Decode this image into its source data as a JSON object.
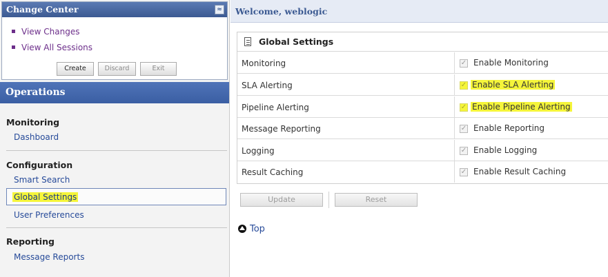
{
  "change_center": {
    "title": "Change Center",
    "collapse_glyph": "≈",
    "links": [
      "View Changes",
      "View All Sessions"
    ],
    "buttons": {
      "create": "Create",
      "discard": "Discard",
      "exit": "Exit"
    }
  },
  "operations": {
    "title": "Operations",
    "sections": [
      {
        "title": "Monitoring",
        "items": [
          "Dashboard"
        ]
      },
      {
        "title": "Configuration",
        "items": [
          "Smart Search",
          "Global Settings",
          "User Preferences"
        ]
      },
      {
        "title": "Reporting",
        "items": [
          "Message Reports"
        ]
      }
    ],
    "selected_item": "Global Settings"
  },
  "welcome": "Welcome, weblogic",
  "global_settings": {
    "title": "Global Settings",
    "rows": [
      {
        "label": "Monitoring",
        "option": "Enable Monitoring",
        "checked": true,
        "highlighted": false
      },
      {
        "label": "SLA Alerting",
        "option": "Enable SLA Alerting",
        "checked": true,
        "highlighted": true
      },
      {
        "label": "Pipeline Alerting",
        "option": "Enable Pipeline Alerting",
        "checked": true,
        "highlighted": true
      },
      {
        "label": "Message Reporting",
        "option": "Enable Reporting",
        "checked": true,
        "highlighted": false
      },
      {
        "label": "Logging",
        "option": "Enable Logging",
        "checked": true,
        "highlighted": false
      },
      {
        "label": "Result Caching",
        "option": "Enable Result Caching",
        "checked": true,
        "highlighted": false
      }
    ]
  },
  "actions": {
    "update": "Update",
    "reset": "Reset"
  },
  "top_link": "Top",
  "colors": {
    "header_blue": "#3c5a92",
    "link_blue": "#264a99",
    "visited_purple": "#6c2e8a",
    "highlight_yellow": "#f5f53a"
  },
  "icons": {
    "collapse": "collapse-icon",
    "settings": "document-icon",
    "top": "up-arrow-circle-icon",
    "checkbox": "checkmark-icon"
  }
}
